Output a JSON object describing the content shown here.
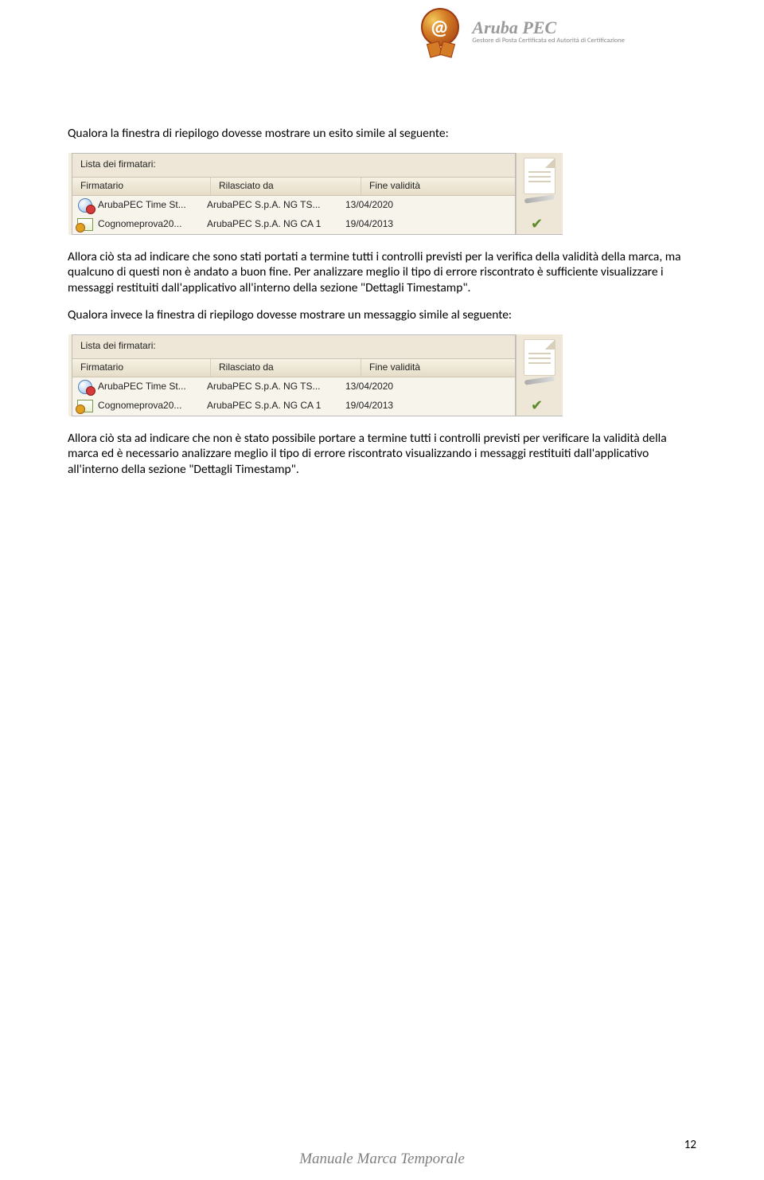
{
  "header": {
    "brand": "Aruba PEC",
    "tagline": "Gestore di Posta Certificata ed Autorità di Certificazione"
  },
  "para1": "Qualora la finestra di riepilogo dovesse mostrare un esito simile al seguente:",
  "para2": "Allora ciò sta ad indicare che sono stati portati a termine tutti i controlli previsti per la verifica della validità della marca, ma qualcuno di questi non è andato a buon fine. Per analizzare meglio il tipo di errore riscontrato è sufficiente visualizzare i messaggi restituiti dall'applicativo all'interno della sezione \"Dettagli Timestamp\".",
  "para3": "Qualora invece la finestra di riepilogo dovesse mostrare un messaggio simile al seguente:",
  "para4": "Allora ciò sta ad indicare che non è stato possibile portare a termine tutti i controlli previsti per verificare la validità della marca ed è necessario analizzare meglio il tipo di errore riscontrato visualizzando i messaggi restituiti dall'applicativo all'interno della sezione \"Dettagli Timestamp\".",
  "signerList": {
    "title": "Lista dei firmatari:",
    "columns": {
      "firmatario": "Firmatario",
      "rilasciato": "Rilasciato da",
      "fine": "Fine validità"
    },
    "rows": [
      {
        "firmatario": "ArubaPEC Time St...",
        "rilasciato": "ArubaPEC S.p.A. NG TS...",
        "fine": "13/04/2020"
      },
      {
        "firmatario": "Cognomeprova20...",
        "rilasciato": "ArubaPEC S.p.A. NG CA 1",
        "fine": "19/04/2013"
      }
    ]
  },
  "footer": "Manuale Marca Temporale",
  "pageNumber": "12"
}
